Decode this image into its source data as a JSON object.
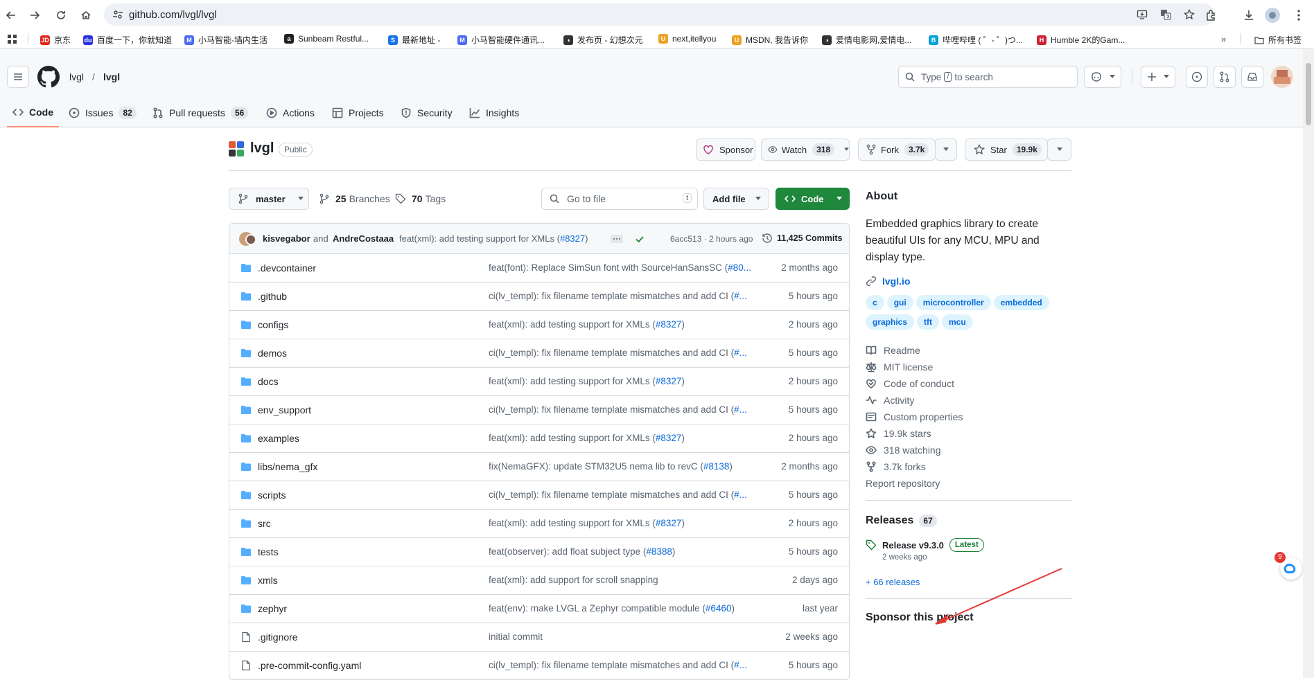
{
  "browser": {
    "url": "github.com/lvgl/lvgl",
    "bookmarks": [
      {
        "label": "京东",
        "color": "#e1251b",
        "glyph": "JD"
      },
      {
        "label": "百度一下，你就知道",
        "color": "#2932e1",
        "glyph": "du"
      },
      {
        "label": "小马智能-墙内生活",
        "color": "#4a6cf7",
        "glyph": "M"
      },
      {
        "label": "Sunbeam Restful...",
        "color": "#222222",
        "glyph": "a"
      },
      {
        "label": "最新地址 -",
        "color": "#1a73e8",
        "glyph": "S"
      },
      {
        "label": "小马智能硬件通讯...",
        "color": "#4a6cf7",
        "glyph": "M"
      },
      {
        "label": "发布页 - 幻想次元",
        "color": "#333333",
        "glyph": "◑"
      },
      {
        "label": "next,itellyou",
        "color": "#f0a020",
        "glyph": "U"
      },
      {
        "label": "MSDN, 我告诉你",
        "color": "#f0a020",
        "glyph": "U"
      },
      {
        "label": "爱情电影网,爱情电...",
        "color": "#333333",
        "glyph": "◑"
      },
      {
        "label": "哔哩哔哩 ( ゜- ゜)つ...",
        "color": "#00a1d6",
        "glyph": "B"
      },
      {
        "label": "Humble 2K的Gam...",
        "color": "#cc2233",
        "glyph": "H"
      }
    ],
    "all_bookmarks": "所有书签"
  },
  "header": {
    "owner": "lvgl",
    "repo": "lvgl",
    "search_prefix": "Type",
    "search_key": "/",
    "search_suffix": "to search"
  },
  "nav": {
    "tabs": [
      {
        "label": "Code",
        "count": null
      },
      {
        "label": "Issues",
        "count": "82"
      },
      {
        "label": "Pull requests",
        "count": "56"
      },
      {
        "label": "Actions",
        "count": null
      },
      {
        "label": "Projects",
        "count": null
      },
      {
        "label": "Security",
        "count": null
      },
      {
        "label": "Insights",
        "count": null
      }
    ]
  },
  "repo": {
    "name": "lvgl",
    "visibility": "Public",
    "sponsor": "Sponsor",
    "watch": "Watch",
    "watch_count": "318",
    "fork": "Fork",
    "fork_count": "3.7k",
    "star": "Star",
    "star_count": "19.9k"
  },
  "toolbar": {
    "branch": "master",
    "branches_count": "25",
    "branches_label": "Branches",
    "tags_count": "70",
    "tags_label": "Tags",
    "goto_placeholder": "Go to file",
    "goto_key": "t",
    "add_file": "Add file",
    "code": "Code"
  },
  "commit": {
    "author1": "kisvegabor",
    "and": "and",
    "author2": "AndreCostaaa",
    "message": "feat(xml): add testing support for XMLs (",
    "pr": "#8327",
    "close": ")",
    "sha_time": "6acc513 · 2 hours ago",
    "commits": "11,425 Commits"
  },
  "files": [
    {
      "name": ".devcontainer",
      "type": "dir",
      "msg": "feat(font): Replace SimSun font with SourceHanSansSC (",
      "pr": "#80...",
      "close": "",
      "age": "2 months ago"
    },
    {
      "name": ".github",
      "type": "dir",
      "msg": "ci(lv_templ): fix filename template mismatches and add CI (",
      "pr": "#...",
      "close": "",
      "age": "5 hours ago"
    },
    {
      "name": "configs",
      "type": "dir",
      "msg": "feat(xml): add testing support for XMLs (",
      "pr": "#8327",
      "close": ")",
      "age": "2 hours ago"
    },
    {
      "name": "demos",
      "type": "dir",
      "msg": "ci(lv_templ): fix filename template mismatches and add CI (",
      "pr": "#...",
      "close": "",
      "age": "5 hours ago"
    },
    {
      "name": "docs",
      "type": "dir",
      "msg": "feat(xml): add testing support for XMLs (",
      "pr": "#8327",
      "close": ")",
      "age": "2 hours ago"
    },
    {
      "name": "env_support",
      "type": "dir",
      "msg": "ci(lv_templ): fix filename template mismatches and add CI (",
      "pr": "#...",
      "close": "",
      "age": "5 hours ago"
    },
    {
      "name": "examples",
      "type": "dir",
      "msg": "feat(xml): add testing support for XMLs (",
      "pr": "#8327",
      "close": ")",
      "age": "2 hours ago"
    },
    {
      "name": "libs/nema_gfx",
      "type": "dir",
      "msg": "fix(NemaGFX): update STM32U5 nema lib to revC (",
      "pr": "#8138",
      "close": ")",
      "age": "2 months ago"
    },
    {
      "name": "scripts",
      "type": "dir",
      "msg": "ci(lv_templ): fix filename template mismatches and add CI (",
      "pr": "#...",
      "close": "",
      "age": "5 hours ago"
    },
    {
      "name": "src",
      "type": "dir",
      "msg": "feat(xml): add testing support for XMLs (",
      "pr": "#8327",
      "close": ")",
      "age": "2 hours ago"
    },
    {
      "name": "tests",
      "type": "dir",
      "msg": "feat(observer): add float subject type (",
      "pr": "#8388",
      "close": ")",
      "age": "5 hours ago"
    },
    {
      "name": "xmls",
      "type": "dir",
      "msg": "feat(xml): add support for scroll snapping",
      "pr": "",
      "close": "",
      "age": "2 days ago"
    },
    {
      "name": "zephyr",
      "type": "dir",
      "msg": "feat(env): make LVGL a Zephyr compatible module (",
      "pr": "#6460",
      "close": ")",
      "age": "last year"
    },
    {
      "name": ".gitignore",
      "type": "file",
      "msg": "initial commit",
      "pr": "",
      "close": "",
      "age": "2 weeks ago"
    },
    {
      "name": ".pre-commit-config.yaml",
      "type": "file",
      "msg": "ci(lv_templ): fix filename template mismatches and add CI (",
      "pr": "#...",
      "close": "",
      "age": "5 hours ago"
    }
  ],
  "about": {
    "title": "About",
    "description": "Embedded graphics library to create beautiful UIs for any MCU, MPU and display type.",
    "website": "lvgl.io",
    "topics": [
      "c",
      "gui",
      "microcontroller",
      "embedded",
      "graphics",
      "tft",
      "mcu"
    ],
    "links": [
      {
        "icon": "book-icon",
        "label": "Readme"
      },
      {
        "icon": "scale-icon",
        "label": "MIT license"
      },
      {
        "icon": "heart-handshake-icon",
        "label": "Code of conduct"
      },
      {
        "icon": "pulse-icon",
        "label": "Activity"
      },
      {
        "icon": "note-icon",
        "label": "Custom properties"
      },
      {
        "icon": "star-icon",
        "label": "19.9k stars"
      },
      {
        "icon": "eye-icon",
        "label": "318 watching"
      },
      {
        "icon": "fork-icon",
        "label": "3.7k forks"
      }
    ],
    "report": "Report repository"
  },
  "releases": {
    "title": "Releases",
    "count": "67",
    "latest_name": "Release v9.3.0",
    "latest_badge": "Latest",
    "latest_time": "2 weeks ago",
    "more": "+ 66 releases"
  },
  "sponsor_title": "Sponsor this project",
  "notification_count": "9",
  "colors": {
    "accent": "#0969da",
    "green": "#1f883d",
    "annotation": "#e53935"
  }
}
